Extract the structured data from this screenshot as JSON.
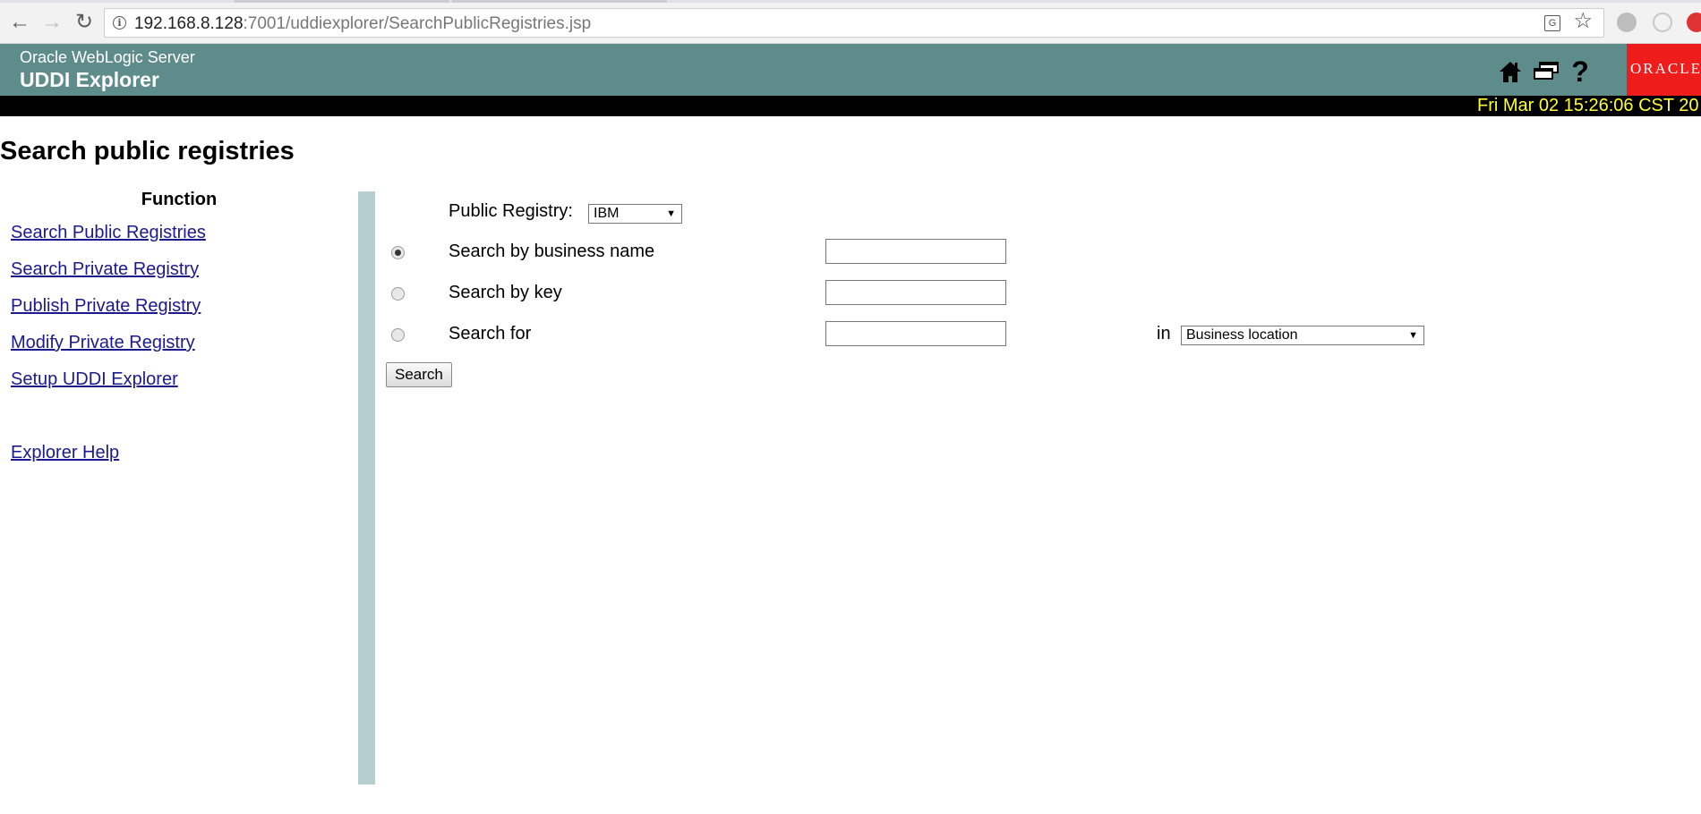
{
  "browser": {
    "url_host": "192.168.8.128",
    "url_rest": ":7001/uddiexplorer/SearchPublicRegistries.jsp"
  },
  "header": {
    "product": "Oracle WebLogic Server",
    "app_name": "UDDI Explorer",
    "logo_text": "ORACLE",
    "datetime": "Fri Mar 02 15:26:06 CST 20",
    "icons": [
      "home-icon",
      "windows-icon",
      "help-icon"
    ]
  },
  "page": {
    "title": "Search public registries"
  },
  "sidebar": {
    "heading": "Function",
    "links": [
      "Search Public Registries",
      "Search Private Registry",
      "Publish Private Registry",
      "Modify Private Registry",
      "Setup UDDI Explorer"
    ],
    "help_link": "Explorer Help"
  },
  "form": {
    "registry_label": "Public Registry:",
    "registry_selected": "IBM",
    "options": [
      {
        "label": "Search by business name",
        "checked": true,
        "value": ""
      },
      {
        "label": "Search by key",
        "checked": false,
        "value": ""
      },
      {
        "label": "Search for",
        "checked": false,
        "value": ""
      }
    ],
    "in_label": "in",
    "in_selected": "Business location",
    "search_button": "Search"
  },
  "colors": {
    "header_bg": "#5e8c8a",
    "divider": "#b6cecd",
    "datetime": "#ffff33",
    "link": "#1a1a8c",
    "oracle_red": "#ef1c1c"
  }
}
